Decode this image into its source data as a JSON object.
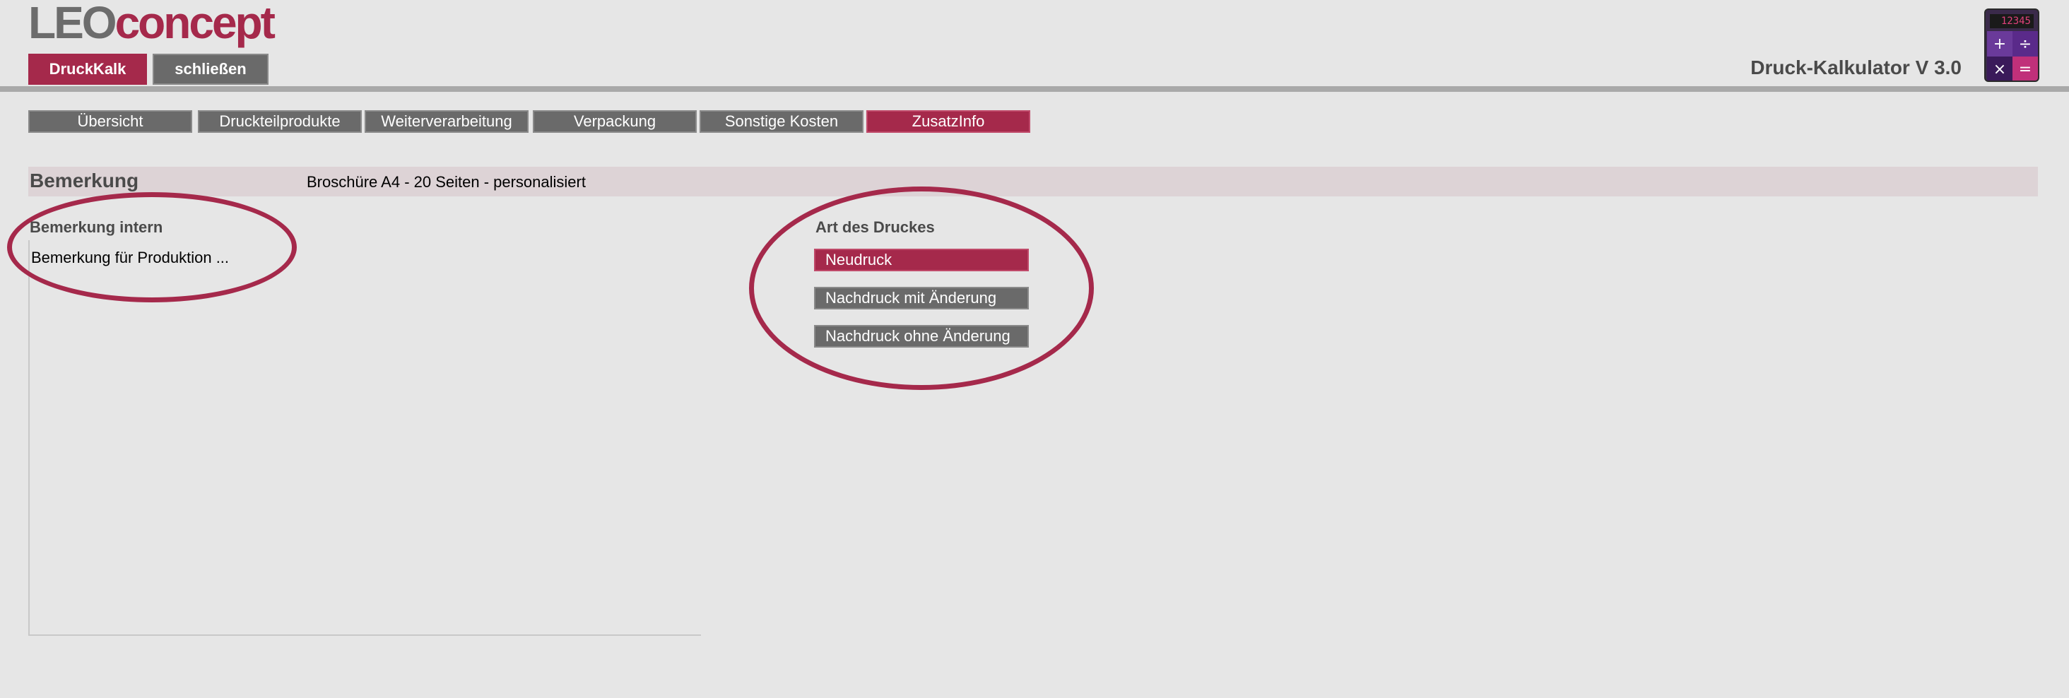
{
  "header": {
    "logo": {
      "part1": "LEO",
      "part2": "concept"
    },
    "buttons": {
      "druckkalk": "DruckKalk",
      "schliessen": "schließen"
    },
    "app_title": "Druck-Kalkulator V 3.0",
    "calculator": {
      "display": "12345",
      "keys": [
        "+",
        "÷",
        "×",
        "="
      ]
    }
  },
  "tabs": [
    {
      "label": "Übersicht",
      "active": false
    },
    {
      "label": "Druckteilprodukte",
      "active": false
    },
    {
      "label": "Weiterverarbeitung",
      "active": false
    },
    {
      "label": "Verpackung",
      "active": false
    },
    {
      "label": "Sonstige Kosten",
      "active": false
    },
    {
      "label": "ZusatzInfo",
      "active": true
    }
  ],
  "bemerkung": {
    "label": "Bemerkung",
    "value": "Broschüre A4 - 20 Seiten - personalisiert"
  },
  "bemerkung_intern": {
    "label": "Bemerkung intern",
    "value": "Bemerkung für Produktion ..."
  },
  "art_des_druckes": {
    "label": "Art des Druckes",
    "options": [
      {
        "label": "Neudruck",
        "selected": true
      },
      {
        "label": "Nachdruck mit Änderung",
        "selected": false
      },
      {
        "label": "Nachdruck ohne Änderung",
        "selected": false
      }
    ]
  },
  "colors": {
    "accent": "#a5294b",
    "button_gray": "#6a6a6a",
    "background": "#e6e6e6",
    "bar_pink": "#ddd3d6"
  }
}
